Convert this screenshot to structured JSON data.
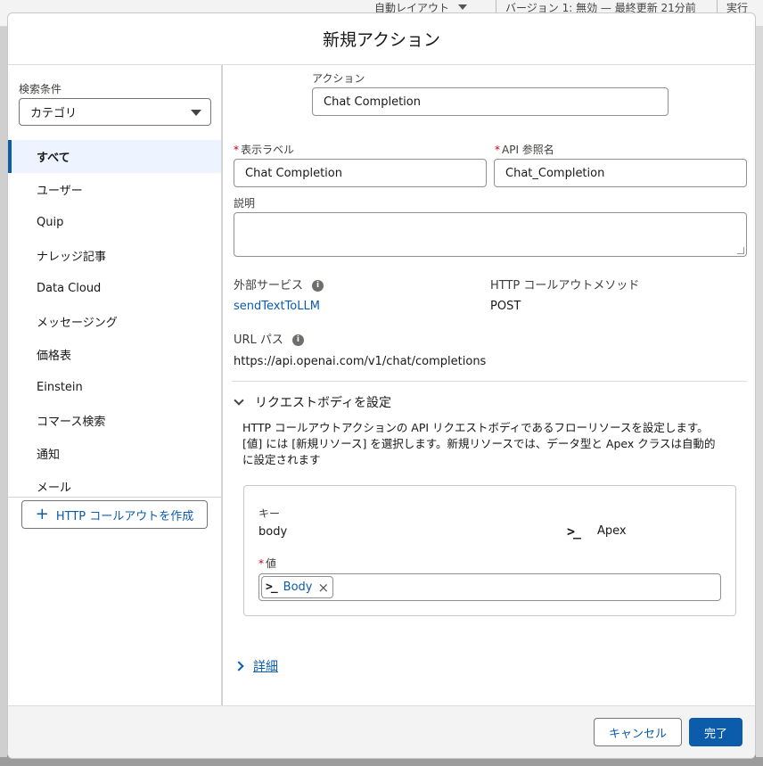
{
  "background": {
    "layout_select": "自動レイアウト",
    "version_text": "バージョン 1: 無効 — 最終更新 21分前",
    "run_link": "実行"
  },
  "modal": {
    "title": "新規アクション",
    "left": {
      "filter_label": "検索条件",
      "category_select": "カテゴリ",
      "categories": [
        "すべて",
        "ユーザー",
        "Quip",
        "ナレッジ記事",
        "Data Cloud",
        "メッセージング",
        "価格表",
        "Einstein",
        "コマース検索",
        "通知",
        "メール"
      ],
      "active_category": "すべて",
      "new_button": "HTTP コールアウトを作成"
    },
    "right": {
      "action_label": "アクション",
      "action_value": "Chat Completion",
      "display_label": "表示ラベル",
      "display_value": "Chat Completion",
      "api_label": "API 参照名",
      "api_value": "Chat_Completion",
      "description_label": "説明",
      "description_value": "",
      "external_service_label": "外部サービス",
      "external_service_value": "sendTextToLLM",
      "http_method_label": "HTTP コールアウトメソッド",
      "http_method_value": "POST",
      "url_label": "URL パス",
      "url_value": "https://api.openai.com/v1/chat/completions",
      "section_title": "リクエストボディを設定",
      "section_desc_1": "HTTP コールアウトアクションの API リクエストボディであるフローリソースを設定します。",
      "section_desc_2": "[値] には [新規リソース] を選択します。新規リソースでは、データ型と Apex クラスは自動的",
      "section_desc_3": "に設定されます",
      "key_label": "キー",
      "key_value": "body",
      "type_value": "Apex",
      "value_label": "値",
      "value_pill": "Body",
      "details_link": "詳細"
    },
    "footer": {
      "cancel": "キャンセル",
      "done": "完了"
    }
  },
  "colors": {
    "brand": "#0b5cab",
    "required": "#ba0517"
  }
}
